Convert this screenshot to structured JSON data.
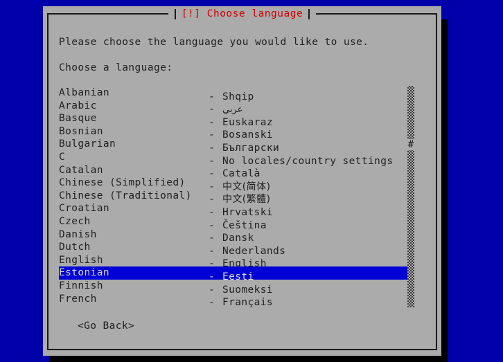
{
  "screen": {
    "background_color": "#0000aa",
    "dialog_background": "#ababab",
    "title_color": "#cc0000",
    "text_color": "#1f1f1f",
    "highlight_color": "#0000d4",
    "highlight_text_color": "#d8d8d8"
  },
  "dialog": {
    "title": "[!] Choose language",
    "prompt_line_1": "Please choose the language you would like to use.",
    "prompt_line_2": "Choose a language:"
  },
  "language_list": {
    "selected_index": 14,
    "scrollbar_thumb_glyph": "#",
    "items": [
      {
        "name": "Albanian",
        "dash": "-",
        "native": "Shqip",
        "script": "latin"
      },
      {
        "name": "Arabic",
        "dash": "-",
        "native": "عربي",
        "script": "rtl"
      },
      {
        "name": "Basque",
        "dash": "-",
        "native": "Euskaraz",
        "script": "latin"
      },
      {
        "name": "Bosnian",
        "dash": "-",
        "native": "Bosanski",
        "script": "latin"
      },
      {
        "name": "Bulgarian",
        "dash": "-",
        "native": "Български",
        "script": "latin"
      },
      {
        "name": "C",
        "dash": "-",
        "native": "No locales/country settings",
        "script": "latin"
      },
      {
        "name": "Catalan",
        "dash": "-",
        "native": "Català",
        "script": "latin"
      },
      {
        "name": "Chinese (Simplified)",
        "dash": "-",
        "native": "中文(简体)",
        "script": "cjk"
      },
      {
        "name": "Chinese (Traditional)",
        "dash": "-",
        "native": "中文(繁體)",
        "script": "cjk"
      },
      {
        "name": "Croatian",
        "dash": "-",
        "native": "Hrvatski",
        "script": "latin"
      },
      {
        "name": "Czech",
        "dash": "-",
        "native": "Čeština",
        "script": "latin"
      },
      {
        "name": "Danish",
        "dash": "-",
        "native": "Dansk",
        "script": "latin"
      },
      {
        "name": "Dutch",
        "dash": "-",
        "native": "Nederlands",
        "script": "latin"
      },
      {
        "name": "English",
        "dash": "-",
        "native": "English",
        "script": "latin"
      },
      {
        "name": "Estonian",
        "dash": "-",
        "native": "Eesti",
        "script": "latin"
      },
      {
        "name": "Finnish",
        "dash": "-",
        "native": "Suomeksi",
        "script": "latin"
      },
      {
        "name": "French",
        "dash": "-",
        "native": "Français",
        "script": "latin"
      }
    ]
  },
  "buttons": {
    "go_back": "<Go Back>"
  }
}
